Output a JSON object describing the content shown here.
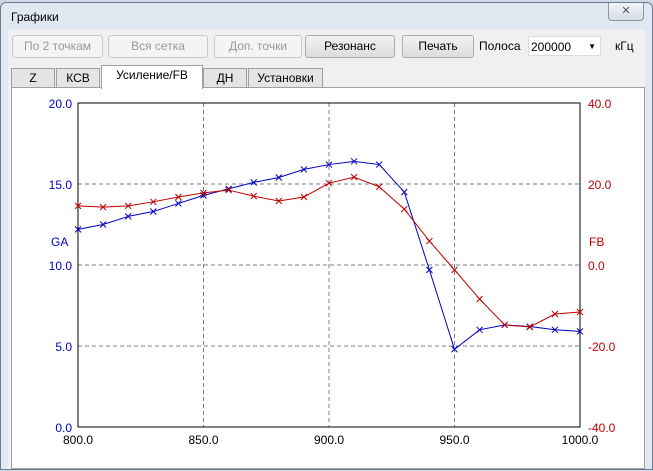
{
  "window": {
    "title": "Графики",
    "close_icon": "close-icon"
  },
  "toolbar": {
    "by2": "По 2 точкам",
    "grid": "Вся сетка",
    "extra": "Доп. точки",
    "resonance": "Резонанс",
    "print": "Печать",
    "band_label": "Полоса",
    "band_value": "200000",
    "unit": "кГц"
  },
  "tabs": [
    {
      "label": "Z"
    },
    {
      "label": "КСВ"
    },
    {
      "label": "Усиление/FB"
    },
    {
      "label": "ДН"
    },
    {
      "label": "Установки"
    }
  ],
  "chart_data": {
    "type": "line",
    "x": [
      800,
      810,
      820,
      830,
      840,
      850,
      860,
      870,
      880,
      890,
      900,
      910,
      920,
      930,
      940,
      950,
      960,
      970,
      980,
      990,
      1000
    ],
    "series": [
      {
        "name": "GA",
        "axis": "left",
        "color": "#0000c0",
        "values": [
          12.2,
          12.5,
          13.0,
          13.3,
          13.8,
          14.3,
          14.7,
          15.1,
          15.4,
          15.9,
          16.2,
          16.4,
          16.2,
          14.5,
          9.7,
          4.8,
          6.0,
          6.3,
          6.2,
          6.0,
          5.9
        ]
      },
      {
        "name": "FB",
        "axis": "right",
        "color": "#c00000",
        "values": [
          14.6,
          14.3,
          14.6,
          15.6,
          16.8,
          17.8,
          18.5,
          17.0,
          15.8,
          16.8,
          20.2,
          21.7,
          19.3,
          13.8,
          5.9,
          -1.2,
          -8.4,
          -14.8,
          -15.3,
          -12.1,
          -11.6
        ]
      }
    ],
    "xlim": [
      800,
      1000
    ],
    "ylim_left": [
      0,
      20
    ],
    "ylim_right": [
      -40,
      40
    ],
    "xticks": [
      "800.0",
      "850.0",
      "900.0",
      "950.0",
      "1000.0"
    ],
    "yticks_left": [
      "20.0",
      "15.0",
      "10.0",
      "5.0",
      "0.0"
    ],
    "yticks_right": [
      "40.0",
      "20.0",
      "0.0",
      "-20.0",
      "-40.0"
    ],
    "ylabel_left": "GA",
    "ylabel_right": "FB",
    "grid": true
  }
}
